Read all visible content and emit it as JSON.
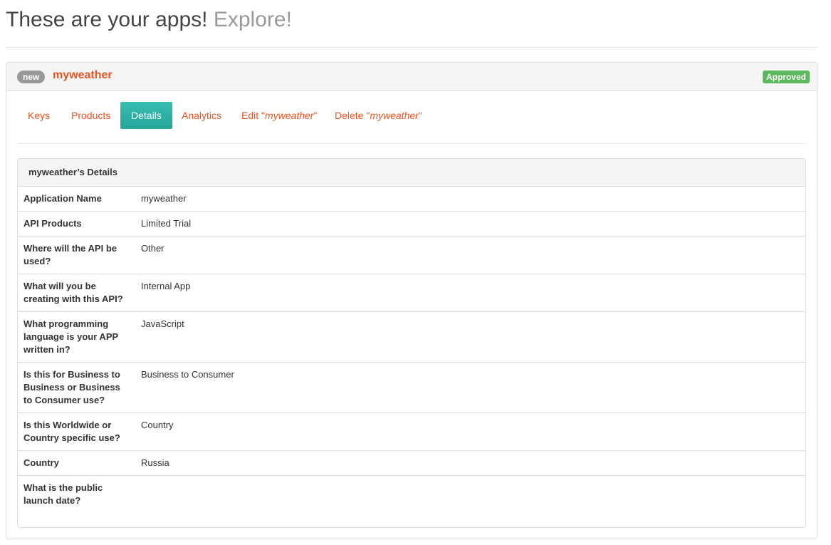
{
  "page": {
    "title_main": "These are your apps!",
    "title_link": "Explore!"
  },
  "app": {
    "badge": "new",
    "name": "myweather",
    "status": "Approved"
  },
  "tabs": [
    {
      "label": "Keys"
    },
    {
      "label": "Products"
    },
    {
      "label": "Details",
      "active": true
    },
    {
      "label": "Analytics"
    },
    {
      "prefix": "Edit \"",
      "name": "myweather",
      "suffix": "\""
    },
    {
      "prefix": "Delete \"",
      "name": "myweather",
      "suffix": "\""
    }
  ],
  "details": {
    "heading": "myweather’s Details",
    "rows": [
      {
        "label": "Application Name",
        "value": "myweather"
      },
      {
        "label": "API Products",
        "value": "Limited Trial"
      },
      {
        "label": "Where will the API be used?",
        "value": "Other"
      },
      {
        "label": "What will you be creating with this API?",
        "value": "Internal App"
      },
      {
        "label": "What programming language is your APP written in?",
        "value": "JavaScript"
      },
      {
        "label": "Is this for Business to Business or Business to Consumer use?",
        "value": "Business to Consumer"
      },
      {
        "label": "Is this Worldwide or Country specific use?",
        "value": "Country"
      },
      {
        "label": "Country",
        "value": "Russia"
      },
      {
        "label": "What is the public launch date?",
        "value": ""
      }
    ]
  },
  "colors": {
    "link": "#e95420",
    "active_tab": "#2bb1a6",
    "approved": "#5cb85c",
    "badge_new": "#999999"
  }
}
